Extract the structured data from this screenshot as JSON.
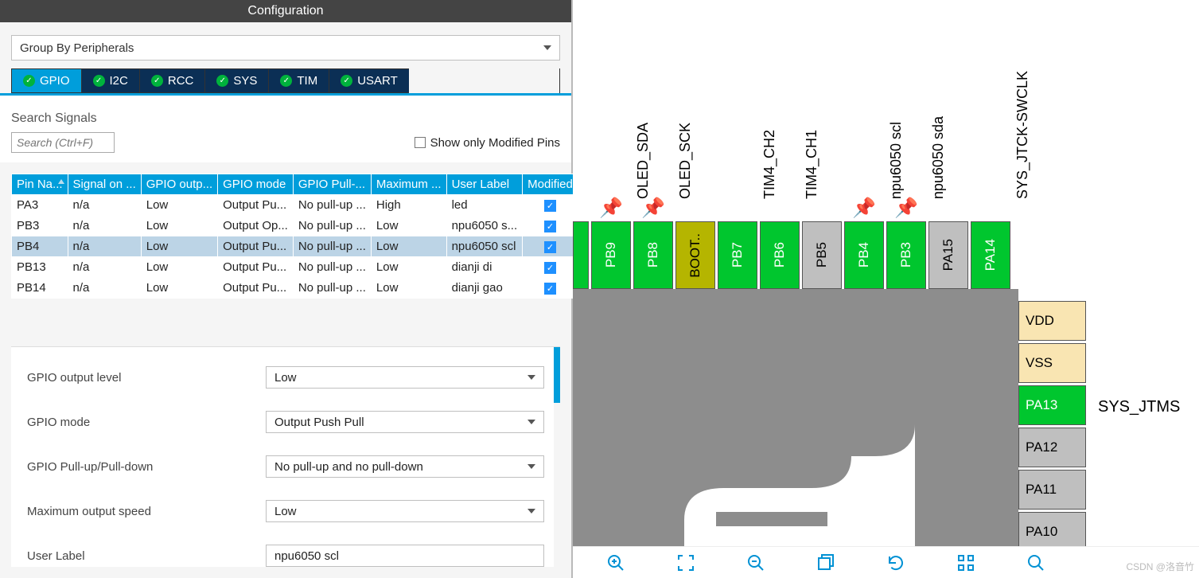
{
  "header": "Configuration",
  "groupby": "Group By Peripherals",
  "tabs": [
    "GPIO",
    "I2C",
    "RCC",
    "SYS",
    "TIM",
    "USART"
  ],
  "search_label": "Search Signals",
  "search_ph": "Search (Ctrl+F)",
  "modlabel": "Show only Modified Pins",
  "cols": [
    "Pin Na...",
    "Signal on ...",
    "GPIO outp...",
    "GPIO mode",
    "GPIO Pull-...",
    "Maximum ...",
    "User Label",
    "Modified"
  ],
  "rows": [
    {
      "c": [
        "PA3",
        "n/a",
        "Low",
        "Output Pu...",
        "No pull-up ...",
        "High",
        "led"
      ],
      "sel": false
    },
    {
      "c": [
        "PB3",
        "n/a",
        "Low",
        "Output Op...",
        "No pull-up ...",
        "Low",
        "npu6050 s..."
      ],
      "sel": false
    },
    {
      "c": [
        "PB4",
        "n/a",
        "Low",
        "Output Pu...",
        "No pull-up ...",
        "Low",
        "npu6050 scl"
      ],
      "sel": true
    },
    {
      "c": [
        "PB13",
        "n/a",
        "Low",
        "Output Pu...",
        "No pull-up ...",
        "Low",
        "dianji di"
      ],
      "sel": false
    },
    {
      "c": [
        "PB14",
        "n/a",
        "Low",
        "Output Pu...",
        "No pull-up ...",
        "Low",
        "dianji gao"
      ],
      "sel": false
    }
  ],
  "props": [
    {
      "label": "GPIO output level",
      "value": "Low",
      "type": "select"
    },
    {
      "label": "GPIO mode",
      "value": "Output Push Pull",
      "type": "select"
    },
    {
      "label": "GPIO Pull-up/Pull-down",
      "value": "No pull-up and no pull-down",
      "type": "select"
    },
    {
      "label": "Maximum output speed",
      "value": "Low",
      "type": "select"
    },
    {
      "label": "User Label",
      "value": "npu6050 scl",
      "type": "input"
    }
  ],
  "top_pins": [
    {
      "name": "",
      "color": "green",
      "left": 0,
      "width": 20
    },
    {
      "name": "PB9",
      "color": "green",
      "label": "OLED_SDA",
      "tack": true
    },
    {
      "name": "PB8",
      "color": "green",
      "label": "OLED_SCK",
      "tack": true
    },
    {
      "name": "BOOT..",
      "color": "olive",
      "label": ""
    },
    {
      "name": "PB7",
      "color": "green",
      "label": "TIM4_CH2"
    },
    {
      "name": "PB6",
      "color": "green",
      "label": "TIM4_CH1"
    },
    {
      "name": "PB5",
      "color": "gray",
      "label": ""
    },
    {
      "name": "PB4",
      "color": "green",
      "label": "npu6050 scl",
      "tack": true
    },
    {
      "name": "PB3",
      "color": "green",
      "label": "npu6050 sda",
      "tack": true
    },
    {
      "name": "PA15",
      "color": "gray",
      "label": ""
    },
    {
      "name": "PA14",
      "color": "green",
      "label": "SYS_JTCK-SWCLK"
    }
  ],
  "side_pins": [
    {
      "name": "VDD",
      "color": "tan"
    },
    {
      "name": "VSS",
      "color": "tan"
    },
    {
      "name": "PA13",
      "color": "green",
      "ext": "SYS_JTMS"
    },
    {
      "name": "PA12",
      "color": "gray"
    },
    {
      "name": "PA11",
      "color": "gray"
    },
    {
      "name": "PA10",
      "color": "gray"
    }
  ],
  "ext_label": "SYS_JTMS",
  "watermark": "CSDN @洛音竹"
}
